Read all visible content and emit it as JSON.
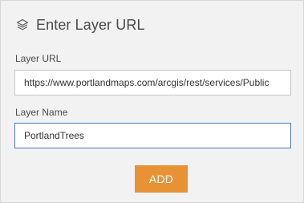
{
  "dialog": {
    "title": "Enter Layer URL",
    "title_icon": "layers-icon"
  },
  "layer_url": {
    "label": "Layer URL",
    "value": "https://www.portlandmaps.com/arcgis/rest/services/Public"
  },
  "layer_name": {
    "label": "Layer Name",
    "value": "PortlandTrees"
  },
  "actions": {
    "add_label": "ADD"
  },
  "colors": {
    "panel_background": "#f2f2f2",
    "add_button": "#e89236",
    "focused_border": "#4f7bb4"
  }
}
